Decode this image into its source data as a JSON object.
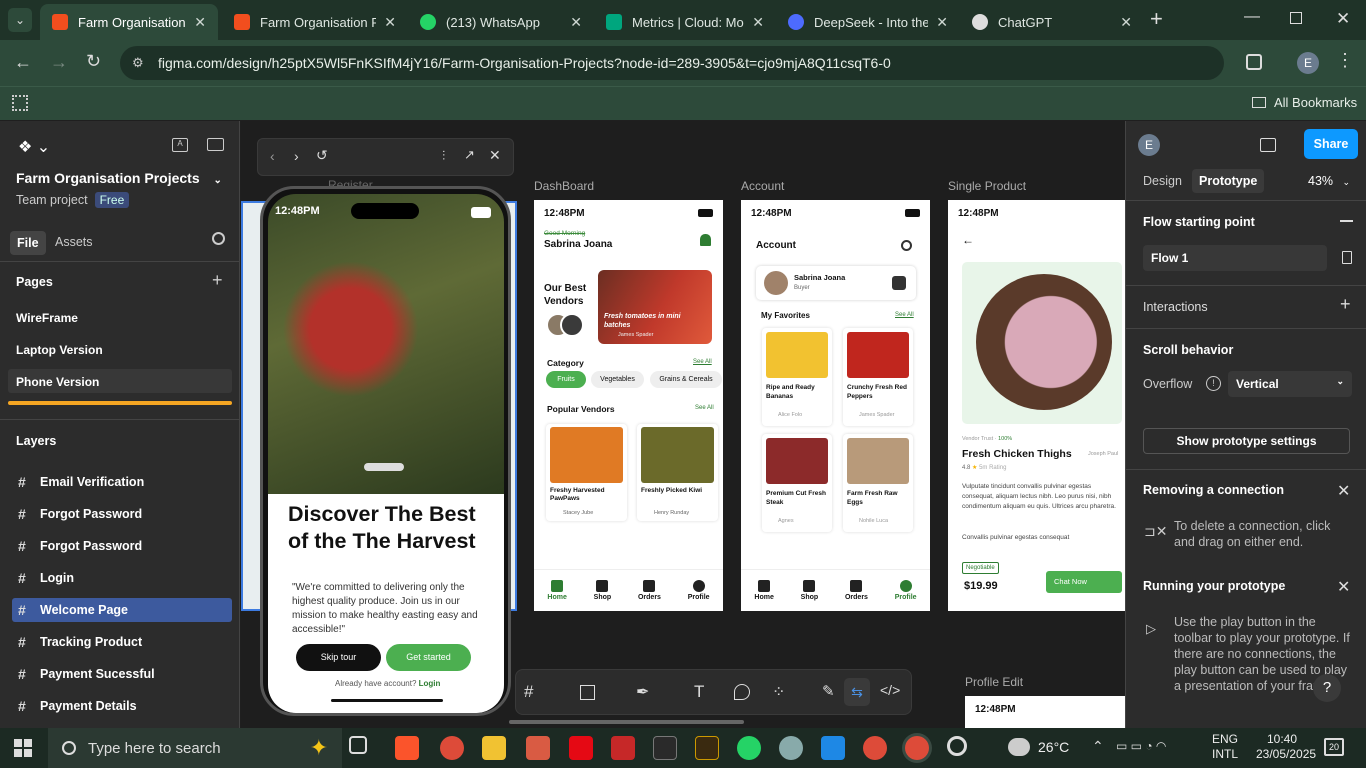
{
  "browser": {
    "tabs": [
      {
        "title": "Farm Organisation Pr",
        "active": true,
        "color": "#f24e1e"
      },
      {
        "title": "Farm Organisation Pr",
        "active": false,
        "color": "#f24e1e"
      },
      {
        "title": "(213) WhatsApp",
        "active": false,
        "color": "#25d366"
      },
      {
        "title": "Metrics | Cloud: Mon",
        "active": false,
        "color": "#00a67e"
      },
      {
        "title": "DeepSeek - Into the U",
        "active": false,
        "color": "#4d6bfe"
      },
      {
        "title": "ChatGPT",
        "active": false,
        "color": "#dddddd"
      }
    ],
    "url": "figma.com/design/h25ptX5Wl5FnKSIfM4jY16/Farm-Organisation-Projects?node-id=289-3905&t=cjo9mjA8Q11csqT6-0",
    "all_bookmarks": "All Bookmarks",
    "profile_initial": "E"
  },
  "figma": {
    "project_title": "Farm Organisation Projects",
    "team": "Team project",
    "plan_badge": "Free",
    "tab_file": "File",
    "tab_assets": "Assets",
    "pages_heading": "Pages",
    "pages": [
      "WireFrame",
      "Laptop Version",
      "Phone Version"
    ],
    "layers_heading": "Layers",
    "layers": [
      "Email Verification",
      "Forgot Password",
      "Forgot Password",
      "Login",
      "Welcome Page",
      "Tracking Product",
      "Payment Sucessful",
      "Payment Details"
    ],
    "selected_layer": "Welcome Page",
    "share": "Share",
    "tab_design": "Design",
    "tab_prototype": "Prototype",
    "zoom": "43%",
    "flow_starting_point": "Flow starting point",
    "flow_name": "Flow 1",
    "interactions": "Interactions",
    "scroll_behavior": "Scroll behavior",
    "overflow_label": "Overflow",
    "overflow_value": "Vertical",
    "show_proto_settings": "Show prototype settings",
    "removing_title": "Removing a connection",
    "removing_text": "To delete a connection, click and drag on either end.",
    "running_title": "Running your prototype",
    "running_text": "Use the play button in the toolbar to play your prototype. If there are no connections, the play button can be used to play a presentation of your frame",
    "help": "?"
  },
  "frames": {
    "labels": {
      "dashboard": "DashBoard",
      "account": "Account",
      "single": "Single Product",
      "profile_edit": "Profile Edit",
      "register": "Register"
    },
    "welcome": {
      "time": "12:48PM",
      "headline": "Discover The Best of the The Harvest",
      "quote": "\"We're committed to delivering only the highest quality produce. Join us in our mission to make healthy easting easy and accessible!\"",
      "skip": "Skip tour",
      "start": "Get started",
      "have_account": "Already have account?",
      "login": "Login"
    },
    "dashboard": {
      "time": "12:48PM",
      "greeting": "Good Morning",
      "name": "Sabrina Joana",
      "best_vendors": "Our Best Vendors",
      "promo": "Fresh tomatoes in mini batches",
      "promo_by": "James Spader",
      "category": "Category",
      "see_all": "See All",
      "cats": [
        "Fruits",
        "Vegetables",
        "Grains & Cereals"
      ],
      "popular": "Popular Vendors",
      "vendors": [
        {
          "name": "Freshy Harvested PawPaws",
          "by": "Stacey Jube"
        },
        {
          "name": "Freshly Picked Kiwi",
          "by": "Henry Runday"
        }
      ]
    },
    "account": {
      "time": "12:48PM",
      "title": "Account",
      "user": "Sabrina Joana",
      "role": "Buyer",
      "favorites": "My Favorites",
      "see_all": "See All",
      "items": [
        {
          "name": "Ripe and Ready Bananas",
          "by": "Alice Folo"
        },
        {
          "name": "Crunchy Fresh Red Peppers",
          "by": "James Spader"
        },
        {
          "name": "Premium Cut Fresh Steak",
          "by": "Agnes"
        },
        {
          "name": "Farm Fresh Raw Eggs",
          "by": "Nohile Luca"
        }
      ]
    },
    "single": {
      "time": "12:48PM",
      "vendor": "Vendor Trust",
      "trust": "100%",
      "product": "Fresh Chicken Thighs",
      "seller": "Joseph Paul",
      "rating": "4.8",
      "rating_label": "5m Rating",
      "desc": "Vulputate tincidunt convallis pulvinar egestas consequat, aliquam lectus nibh. Leo purus nisi, nibh condimentum aliquam eu quis. Ultrices arcu pharetra.",
      "desc2": "Convallis pulvinar egestas consequat",
      "negotiable": "Negotiable",
      "price": "$19.99",
      "chat": "Chat Now"
    },
    "profile_edit_time": "12:48PM",
    "nav": [
      "Home",
      "Shop",
      "Orders",
      "Profile"
    ]
  },
  "taskbar": {
    "search": "Type here to search",
    "temp": "26°C",
    "lang1": "ENG",
    "lang2": "INTL",
    "time": "10:40",
    "date": "23/05/2025",
    "notif": "20"
  }
}
